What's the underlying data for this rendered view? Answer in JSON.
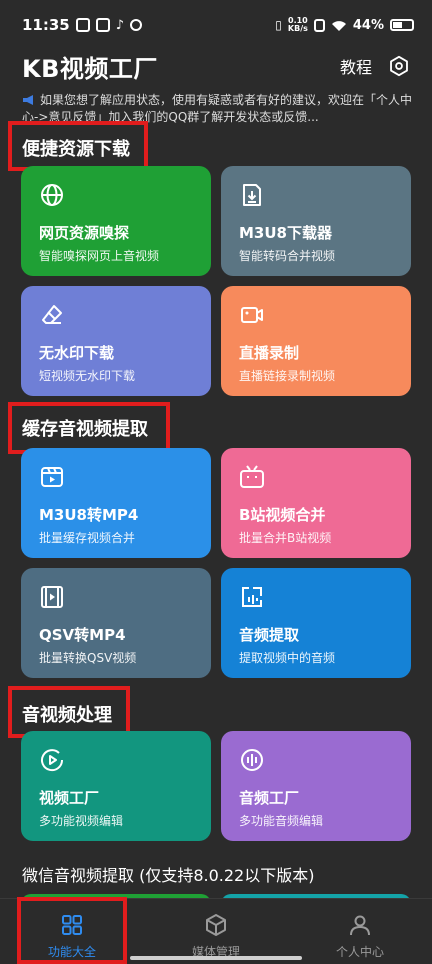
{
  "status": {
    "time": "11:35",
    "net_speed_value": "0.10",
    "net_speed_unit": "KB/s",
    "battery": "44%"
  },
  "header": {
    "title": "KB视频工厂",
    "tutorial": "教程"
  },
  "notice": {
    "text": "如果您想了解应用状态，使用有疑惑或者有好的建议，欢迎在「个人中心->意见反馈」加入我们的QQ群了解开发状态或反馈..."
  },
  "sections": [
    {
      "title": "便捷资源下载"
    },
    {
      "title": "缓存音视频提取"
    },
    {
      "title": "音视频处理"
    },
    {
      "title": "微信音视频提取 (仅支持8.0.22以下版本)"
    }
  ],
  "cards": [
    {
      "title": "网页资源嗅探",
      "sub": "智能嗅探网页上音视频",
      "icon": "globe-icon",
      "color": "#1fa035"
    },
    {
      "title": "M3U8下载器",
      "sub": "智能转码合并视频",
      "icon": "download-file-icon",
      "color": "#5b7583"
    },
    {
      "title": "无水印下载",
      "sub": "短视频无水印下载",
      "icon": "eraser-icon",
      "color": "#6f7fd6"
    },
    {
      "title": "直播录制",
      "sub": "直播链接录制视频",
      "icon": "video-camera-icon",
      "color": "#f78a5c"
    },
    {
      "title": "M3U8转MP4",
      "sub": "批量缓存视频合并",
      "icon": "video-clip-icon",
      "color": "#2b90e8"
    },
    {
      "title": "B站视频合并",
      "sub": "批量合并B站视频",
      "icon": "bilibili-tv-icon",
      "color": "#ef6a95"
    },
    {
      "title": "QSV转MP4",
      "sub": "批量转换QSV视频",
      "icon": "film-icon",
      "color": "#4e6d82"
    },
    {
      "title": "音频提取",
      "sub": "提取视频中的音频",
      "icon": "audio-extract-icon",
      "color": "#1582d6"
    },
    {
      "title": "视频工厂",
      "sub": "多功能视频编辑",
      "icon": "play-circle-icon",
      "color": "#12967f"
    },
    {
      "title": "音频工厂",
      "sub": "多功能音频编辑",
      "icon": "sound-wave-icon",
      "color": "#9a6bd1"
    }
  ],
  "tabs": [
    {
      "label": "功能大全",
      "icon": "grid-icon",
      "active": true
    },
    {
      "label": "媒体管理",
      "icon": "box-icon",
      "active": false
    },
    {
      "label": "个人中心",
      "icon": "person-icon",
      "active": false
    }
  ],
  "colors": {
    "accent": "#2f8cf0",
    "highlight": "#e11d1d",
    "background": "#2b2b2b"
  }
}
